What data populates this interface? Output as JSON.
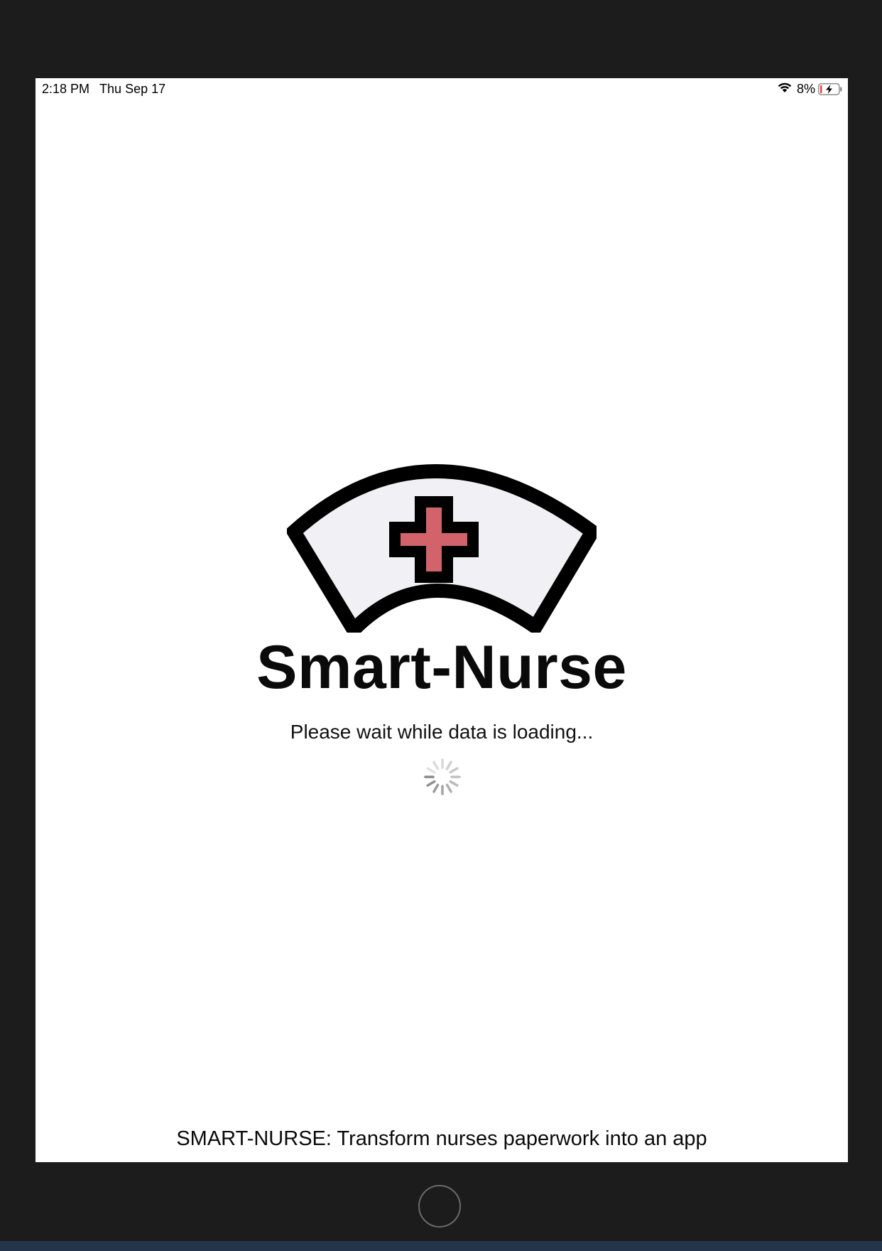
{
  "status_bar": {
    "time": "2:18 PM",
    "date": "Thu Sep 17",
    "battery_percent": "8%",
    "wifi_icon": "wifi-icon",
    "battery_icon": "battery-charging-icon"
  },
  "app": {
    "logo_icon": "nurse-cap-icon",
    "title": "Smart-Nurse",
    "loading_message": "Please wait while data is loading...",
    "spinner_icon": "activity-spinner-icon",
    "footer": "SMART-NURSE: Transform nurses paperwork into an app"
  },
  "colors": {
    "cross": "#d2636b",
    "cap_fill": "#f1f1f5",
    "outline": "#000000",
    "battery_low": "#e5443a"
  }
}
